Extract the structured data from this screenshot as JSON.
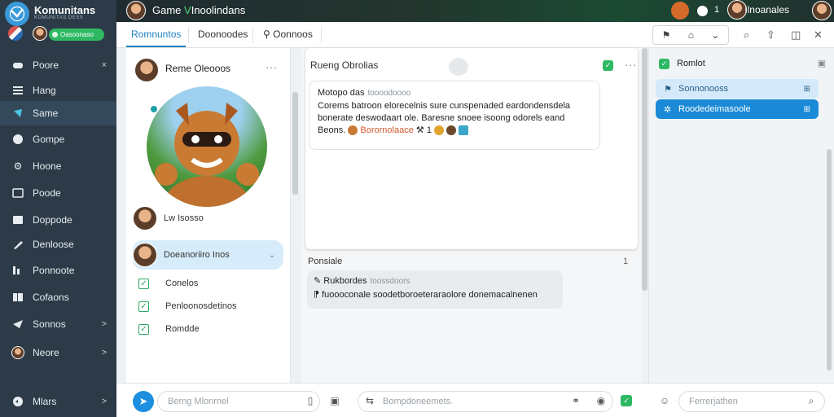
{
  "app": {
    "name": "Komunitans",
    "tagline": "KOMUNITAS DESS",
    "status_pill": "Oasoonaso"
  },
  "topbar": {
    "title_prefix": "Game",
    "title_accent": "V",
    "title_rest": "Inoolindans",
    "user_name": "Ilnoanales",
    "notif_count": "1"
  },
  "sidebar": {
    "items": [
      {
        "label": "Poore",
        "icon": "gamepad-icon",
        "chevron": "×"
      },
      {
        "label": "Hang",
        "icon": "menu-icon",
        "chevron": ""
      },
      {
        "label": "Same",
        "icon": "controller-icon",
        "chevron": ""
      },
      {
        "label": "Gompe",
        "icon": "globe-icon",
        "chevron": ""
      },
      {
        "label": "Hoone",
        "icon": "gear-icon",
        "chevron": ""
      },
      {
        "label": "Poode",
        "icon": "inbox-icon",
        "chevron": ""
      },
      {
        "label": "Doppode",
        "icon": "clipboard-icon",
        "chevron": ""
      },
      {
        "label": "Denloose",
        "icon": "pen-icon",
        "chevron": ""
      },
      {
        "label": "Ponnoote",
        "icon": "chart-icon",
        "chevron": ""
      },
      {
        "label": "Cofaons",
        "icon": "book-icon",
        "chevron": ""
      },
      {
        "label": "Sonnos",
        "icon": "send-icon",
        "chevron": ">"
      },
      {
        "label": "Neore",
        "icon": "avatar-icon",
        "chevron": ">"
      }
    ],
    "footer": {
      "label": "Mlars",
      "chevron": ">"
    }
  },
  "tabs": [
    {
      "label": "Romnuntos"
    },
    {
      "label": "Doonoodes"
    },
    {
      "label": "Oonnoos"
    }
  ],
  "left_panel": {
    "header_name": "Reme Oleooos",
    "dots": "···",
    "list": [
      {
        "label": "Lw Isosso"
      },
      {
        "label": "Doeanoriiro Inos"
      }
    ],
    "checks": [
      {
        "label": "Conelos"
      },
      {
        "label": "Penloonosdetinos"
      },
      {
        "label": "Romdde"
      }
    ]
  },
  "chat": {
    "title": "Rueng Obrolias",
    "dots": "···",
    "message": {
      "sender": "Motopo das",
      "time": "toooodoooo",
      "line1": "Corems batroon elorecelnis sure cunspenaded eardondensdela",
      "line2": "bonerate deswodaart ole. Baresne snoee isoong odorels eand",
      "line3_prefix": "Beons.",
      "line3_highlight": "Borornolaace",
      "line3_suffix": "1"
    },
    "section_label": "Ponsiale",
    "section_icon": "1",
    "reply": {
      "sender": "Rukbordes",
      "time": "toossdoors",
      "body": "fuoooconale soodetboroeteraraolore donemacalnenen"
    }
  },
  "right_panel": {
    "header": "Romlot",
    "items": [
      {
        "label": "Sonnonooss",
        "end": "⊞"
      },
      {
        "label": "Roodedeimasoole",
        "end": "⊞"
      }
    ]
  },
  "bottom": {
    "input_left_placeholder": "Berng Mlonrnel",
    "input_mid_placeholder": "Bompdoneemets.",
    "input_right_placeholder": "Ferrerjathen"
  },
  "colors": {
    "sidebar_bg": "#2c3b47",
    "accent_blue": "#1b7fc2",
    "accent_green": "#2fb864"
  }
}
